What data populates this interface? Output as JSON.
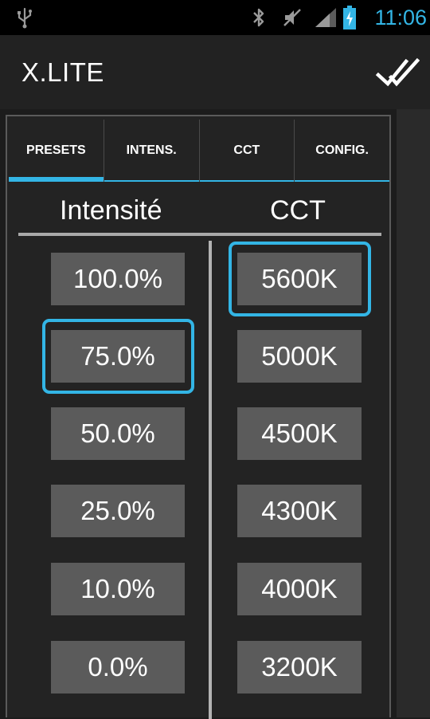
{
  "status_bar": {
    "time": "11:06",
    "icons": [
      "usb-icon",
      "bluetooth-icon",
      "mute-icon",
      "signal-icon",
      "battery-charging-icon"
    ],
    "accent_color": "#33b5e5"
  },
  "action_bar": {
    "title": "X.LITE",
    "done_icon": "double-check-icon"
  },
  "tabs": [
    {
      "label": "PRESETS",
      "active": true
    },
    {
      "label": "INTENS.",
      "active": false
    },
    {
      "label": "CCT",
      "active": false
    },
    {
      "label": "CONFIG.",
      "active": false
    }
  ],
  "intensity": {
    "header": "Intensité",
    "presets": [
      "100.0%",
      "75.0%",
      "50.0%",
      "25.0%",
      "10.0%",
      "0.0%"
    ],
    "selected": "75.0%"
  },
  "cct": {
    "header": "CCT",
    "presets": [
      "5600K",
      "5000K",
      "4500K",
      "4300K",
      "4000K",
      "3200K"
    ],
    "selected": "5600K"
  },
  "colors": {
    "accent": "#33b5e5",
    "button": "#5b5b5b",
    "panel": "#232323"
  }
}
